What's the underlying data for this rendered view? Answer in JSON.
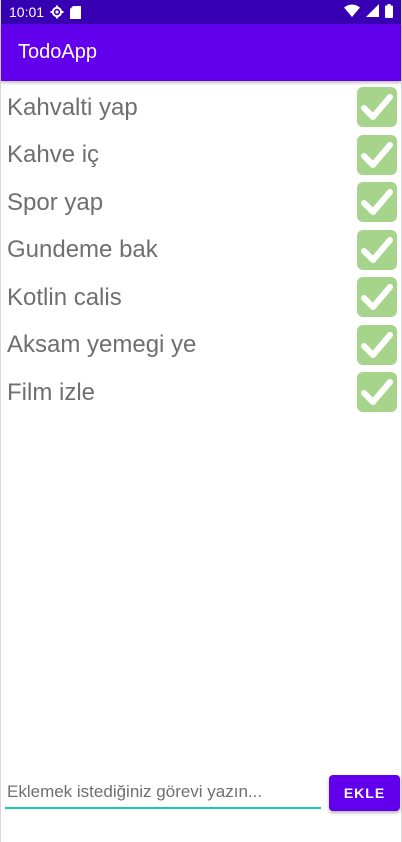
{
  "status_bar": {
    "time": "10:01",
    "icons": [
      "settings-gear-icon",
      "sd-card-icon",
      "wifi-icon",
      "cellular-signal-icon",
      "battery-icon"
    ]
  },
  "app_bar": {
    "title": "TodoApp"
  },
  "todos": [
    {
      "label": "Kahvalti yap",
      "icon": "check-mark-icon"
    },
    {
      "label": "Kahve iç",
      "icon": "check-mark-icon"
    },
    {
      "label": "Spor yap",
      "icon": "check-mark-icon"
    },
    {
      "label": "Gundeme bak",
      "icon": "check-mark-icon"
    },
    {
      "label": "Kotlin calis",
      "icon": "check-mark-icon"
    },
    {
      "label": "Aksam yemegi ye",
      "icon": "check-mark-icon"
    },
    {
      "label": "Film izle",
      "icon": "check-mark-icon"
    }
  ],
  "input": {
    "placeholder": "Eklemek istediğiniz görevi yazın...",
    "value": ""
  },
  "add_button": {
    "label": "EKLE"
  },
  "colors": {
    "status_bar": "#3700b3",
    "app_bar": "#6200ee",
    "check_bg": "#a6d48a",
    "input_underline": "#1cc4b5",
    "todo_text": "#6f6f6f"
  }
}
